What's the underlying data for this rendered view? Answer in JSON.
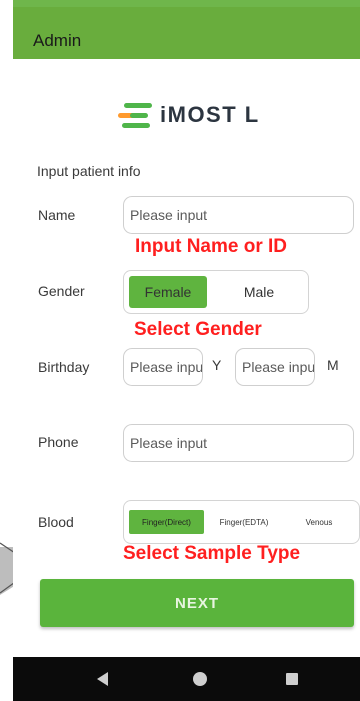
{
  "appbar": {
    "title": "Admin"
  },
  "logo": {
    "text": "iMOST L"
  },
  "form": {
    "section_label": "Input patient info",
    "name": {
      "label": "Name",
      "placeholder": "Please input"
    },
    "gender": {
      "label": "Gender",
      "options": [
        "Female",
        "Male"
      ],
      "selected": "Female"
    },
    "birthday": {
      "label": "Birthday",
      "year_placeholder": "Please input",
      "year_unit": "Y",
      "month_placeholder": "Please input",
      "month_unit": "M"
    },
    "phone": {
      "label": "Phone",
      "placeholder": "Please input"
    },
    "blood": {
      "label": "Blood",
      "options": [
        "Finger(Direct)",
        "Finger(EDTA)",
        "Venous"
      ],
      "selected": "Finger(Direct)"
    },
    "next_label": "NEXT"
  },
  "annotations": {
    "name": "Input Name or ID",
    "gender": "Select Gender",
    "sample": "Select Sample Type"
  },
  "colors": {
    "appbar": "#69ad3d",
    "selected": "#5fb43f",
    "annotation": "#ff1f1f",
    "button": "#5ab43c"
  },
  "navbar": {
    "icons": [
      "back-icon",
      "home-icon",
      "recents-icon"
    ]
  }
}
